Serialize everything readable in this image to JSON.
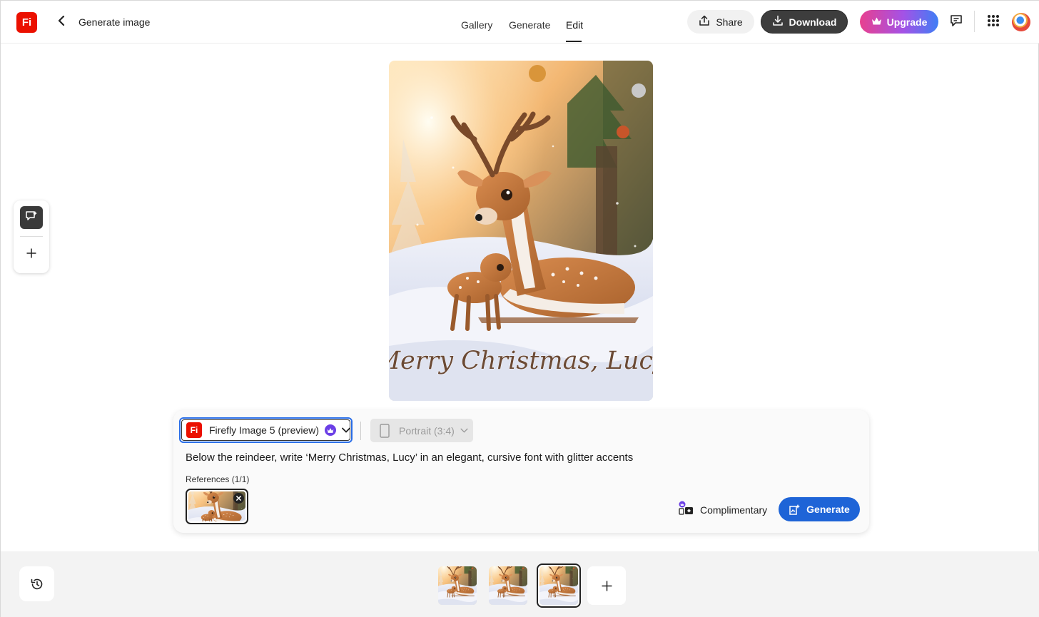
{
  "app": {
    "logo_text": "Fi",
    "page_title": "Generate image"
  },
  "nav": {
    "tabs": [
      {
        "label": "Gallery"
      },
      {
        "label": "Generate"
      },
      {
        "label": "Edit"
      }
    ],
    "active_tab": "Edit"
  },
  "header_actions": {
    "share_label": "Share",
    "download_label": "Download",
    "upgrade_label": "Upgrade"
  },
  "icons": {
    "back": "chevron-left-icon",
    "share": "share-icon",
    "download": "download-icon",
    "upgrade": "crown-icon",
    "feedback": "chat-bubble-icon",
    "apps": "grid-icon",
    "generative_edit": "generative-edit-icon",
    "add": "plus-icon",
    "history": "history-icon"
  },
  "canvas": {
    "image_caption": "Merry Christmas, Lucy"
  },
  "prompt_panel": {
    "model": {
      "logo_text": "Fi",
      "label": "Firefly Image 5 (preview)"
    },
    "aspect_ratio": {
      "label": "Portrait (3:4)",
      "disabled": true
    },
    "prompt": "Below the reindeer, write ‘Merry Christmas, Lucy’ in an elegant, cursive font with glitter accents",
    "references_label": "References (1/1)",
    "credits_label": "Complimentary",
    "generate_label": "Generate"
  },
  "variants": {
    "count": 3,
    "selected_index": 2
  },
  "colors": {
    "brand_red": "#eb1000",
    "generate_blue": "#1e64d7",
    "focus_blue": "#2a6ee8",
    "download_dark": "#3d3d3d",
    "premium_purple": "#6b3fe6"
  }
}
